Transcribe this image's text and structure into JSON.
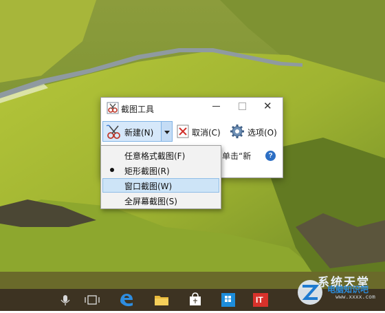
{
  "window": {
    "title": "截图工具",
    "icon": "scissors-icon",
    "controls": {
      "minimize": "minimize-icon",
      "maximize": "maximize-icon",
      "close": "close-icon"
    }
  },
  "toolbar": {
    "new_label": "新建(N)",
    "cancel_label": "取消(C)",
    "options_label": "选项(O)"
  },
  "hint_text": "单击“新",
  "help_glyph": "?",
  "snip_menu": {
    "items": [
      {
        "label": "任意格式截图(F)",
        "selected": false,
        "highlighted": false
      },
      {
        "label": "矩形截图(R)",
        "selected": true,
        "highlighted": false
      },
      {
        "label": "窗口截图(W)",
        "selected": false,
        "highlighted": true
      },
      {
        "label": "全屏幕截图(S)",
        "selected": false,
        "highlighted": false
      }
    ]
  },
  "taskbar": {
    "icons": [
      "microphone-icon",
      "task-view-icon",
      "edge-icon",
      "file-explorer-icon",
      "store-icon",
      "windows-store-icon",
      "it-app-icon"
    ],
    "it_text": "IT"
  },
  "watermark": {
    "line1": "系统天堂",
    "line2": "电脑知识吧",
    "url": "www.xxxx.com"
  },
  "colors": {
    "accent": "#2d6fc4",
    "menu_highlight": "#cde4f7",
    "taskbar": "#3d3322",
    "cancel_red": "#d0302a"
  }
}
